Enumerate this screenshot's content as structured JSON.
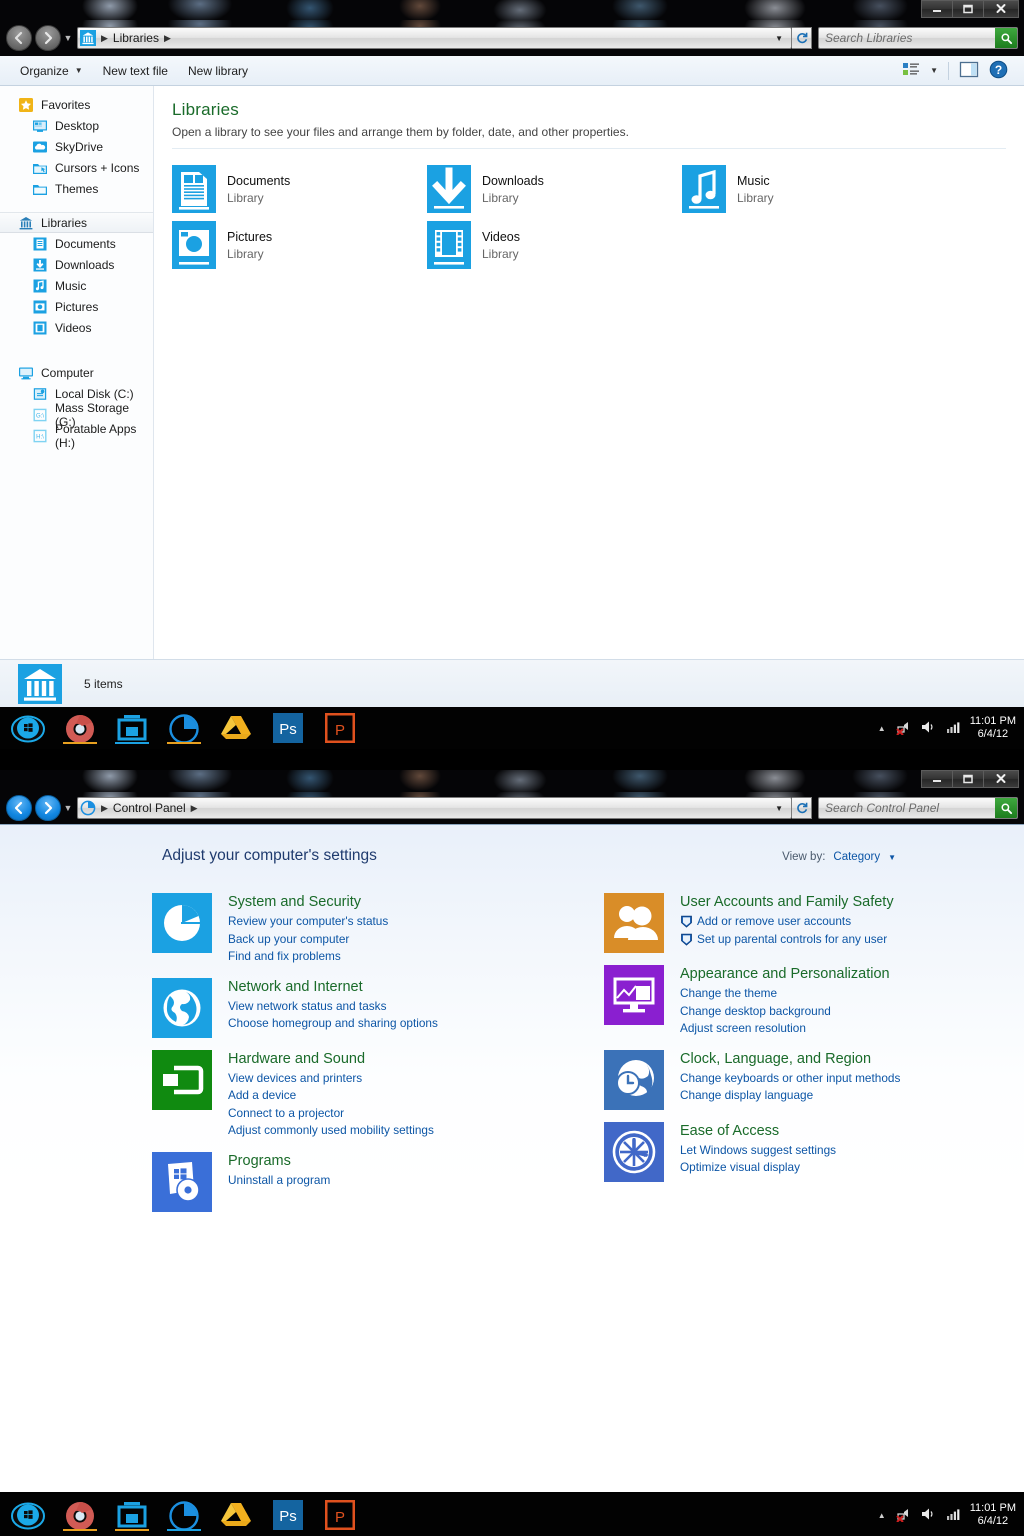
{
  "explorer": {
    "window_controls": {
      "minimize": "minimize-button",
      "maximize": "maximize-button",
      "close": "close-button"
    },
    "address": {
      "crumb": "Libraries",
      "icon": "library-icon"
    },
    "search": {
      "placeholder": "Search Libraries"
    },
    "toolbar": {
      "organize": "Organize",
      "new_text_file": "New text file",
      "new_library": "New library",
      "view_icon": "view-options-icon",
      "preview_icon": "preview-pane-icon",
      "help_icon": "help-icon"
    },
    "sidebar": {
      "groups": [
        {
          "header": "Favorites",
          "header_icon": "star-icon",
          "items": [
            {
              "label": "Desktop",
              "icon": "desktop-icon"
            },
            {
              "label": "SkyDrive",
              "icon": "skydrive-icon"
            },
            {
              "label": "Cursors + Icons",
              "icon": "cursors-folder-icon"
            },
            {
              "label": "Themes",
              "icon": "folder-icon"
            }
          ]
        },
        {
          "header": "Libraries",
          "header_icon": "library-icon",
          "selected": true,
          "items": [
            {
              "label": "Documents",
              "icon": "documents-icon"
            },
            {
              "label": "Downloads",
              "icon": "downloads-icon"
            },
            {
              "label": "Music",
              "icon": "music-icon"
            },
            {
              "label": "Pictures",
              "icon": "pictures-icon"
            },
            {
              "label": "Videos",
              "icon": "videos-icon"
            }
          ]
        },
        {
          "header": "Computer",
          "header_icon": "computer-icon",
          "items": [
            {
              "label": "Local Disk (C:)",
              "icon": "drive-icon"
            },
            {
              "label": "Mass Storage (G:)",
              "icon": "drive-icon"
            },
            {
              "label": "Poratable Apps (H:)",
              "icon": "drive-icon"
            }
          ]
        }
      ]
    },
    "content": {
      "title": "Libraries",
      "subtitle": "Open a library to see your files and arrange them by folder, date, and other properties.",
      "libraries": [
        {
          "name": "Documents",
          "kind": "Library",
          "icon": "documents-library-icon"
        },
        {
          "name": "Downloads",
          "kind": "Library",
          "icon": "downloads-library-icon"
        },
        {
          "name": "Music",
          "kind": "Library",
          "icon": "music-library-icon"
        },
        {
          "name": "Pictures",
          "kind": "Library",
          "icon": "pictures-library-icon"
        },
        {
          "name": "Videos",
          "kind": "Library",
          "icon": "videos-library-icon"
        }
      ]
    },
    "status": {
      "text": "5 items",
      "icon": "library-icon"
    }
  },
  "taskbar": {
    "apps": [
      {
        "name": "start-button",
        "icon": "windows-orb-icon",
        "running": false
      },
      {
        "name": "chrome",
        "icon": "chrome-icon",
        "running": true
      },
      {
        "name": "file-explorer",
        "icon": "explorer-icon",
        "running": true
      },
      {
        "name": "control-panel",
        "icon": "control-panel-icon",
        "running": true
      },
      {
        "name": "google-drive",
        "icon": "google-drive-icon",
        "running": false
      },
      {
        "name": "photoshop",
        "icon": "photoshop-icon",
        "running": false
      },
      {
        "name": "powerpoint",
        "icon": "powerpoint-icon",
        "running": false
      }
    ],
    "tray": {
      "chevron": "show-hidden-icons-chevron",
      "network": "network-error-icon",
      "volume": "volume-icon",
      "signal": "signal-bars-icon",
      "time": "11:01 PM",
      "date": "6/4/12"
    }
  },
  "control_panel": {
    "address": {
      "crumb": "Control Panel",
      "icon": "control-panel-icon"
    },
    "search": {
      "placeholder": "Search Control Panel"
    },
    "heading": "Adjust your computer's settings",
    "view_by": {
      "label": "View by:",
      "value": "Category"
    },
    "colors": {
      "category_title": "#1a6b2a",
      "link": "#0d56a6",
      "system_security": "#1ba1e2",
      "network_internet": "#1ba1e2",
      "hardware_sound": "#108a10",
      "programs": "#3a6fd8",
      "user_accounts": "#d98d28",
      "appearance": "#8a1fd0",
      "clock_region": "#3b72b8",
      "ease_of_access": "#4168c8"
    },
    "left_column": [
      {
        "title": "System and Security",
        "icon": "pie-chart-icon",
        "icon_color": "#1ba1e2",
        "links": [
          {
            "text": "Review your computer's status",
            "shield": false
          },
          {
            "text": "Back up your computer",
            "shield": false
          },
          {
            "text": "Find and fix problems",
            "shield": false
          }
        ]
      },
      {
        "title": "Network and Internet",
        "icon": "globe-icon",
        "icon_color": "#1ba1e2",
        "links": [
          {
            "text": "View network status and tasks",
            "shield": false
          },
          {
            "text": "Choose homegroup and sharing options",
            "shield": false
          }
        ]
      },
      {
        "title": "Hardware and Sound",
        "icon": "device-icon",
        "icon_color": "#108a10",
        "links": [
          {
            "text": "View devices and printers",
            "shield": false
          },
          {
            "text": "Add a device",
            "shield": false
          },
          {
            "text": "Connect to a projector",
            "shield": false
          },
          {
            "text": "Adjust commonly used mobility settings",
            "shield": false
          }
        ]
      },
      {
        "title": "Programs",
        "icon": "programs-disc-icon",
        "icon_color": "#3a6fd8",
        "links": [
          {
            "text": "Uninstall a program",
            "shield": false
          }
        ]
      }
    ],
    "right_column": [
      {
        "title": "User Accounts and Family Safety",
        "icon": "users-icon",
        "icon_color": "#d98d28",
        "links": [
          {
            "text": "Add or remove user accounts",
            "shield": true
          },
          {
            "text": "Set up parental controls for any user",
            "shield": true
          }
        ]
      },
      {
        "title": "Appearance and Personalization",
        "icon": "monitor-icon",
        "icon_color": "#8a1fd0",
        "links": [
          {
            "text": "Change the theme",
            "shield": false
          },
          {
            "text": "Change desktop background",
            "shield": false
          },
          {
            "text": "Adjust screen resolution",
            "shield": false
          }
        ]
      },
      {
        "title": "Clock, Language, and Region",
        "icon": "clock-globe-icon",
        "icon_color": "#3b72b8",
        "links": [
          {
            "text": "Change keyboards or other input methods",
            "shield": false
          },
          {
            "text": "Change display language",
            "shield": false
          }
        ]
      },
      {
        "title": "Ease of Access",
        "icon": "ease-of-access-icon",
        "icon_color": "#4168c8",
        "links": [
          {
            "text": "Let Windows suggest settings",
            "shield": false
          },
          {
            "text": "Optimize visual display",
            "shield": false
          }
        ]
      }
    ]
  }
}
